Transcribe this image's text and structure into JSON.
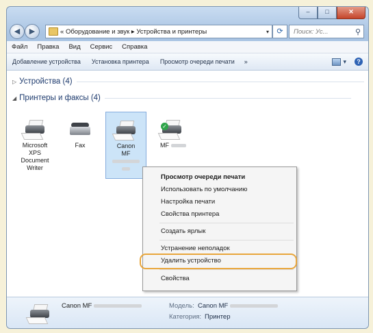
{
  "window": {
    "controls": {
      "minimize": "–",
      "maximize": "□",
      "close": "✕"
    }
  },
  "address": {
    "back": "◀",
    "forward": "▶",
    "breadcrumb_prefix": "«",
    "crumb1": "Оборудование и звук",
    "sep": "▸",
    "crumb2": "Устройства и принтеры",
    "dropdown": "▾",
    "refresh": "⟳",
    "search_placeholder": "Поиск: Ус...",
    "search_glyph": "⚲"
  },
  "menu": [
    "Файл",
    "Правка",
    "Вид",
    "Сервис",
    "Справка"
  ],
  "commands": {
    "add_device": "Добавление устройства",
    "install_printer": "Установка принтера",
    "view_queue": "Просмотр очереди печати",
    "more": "»",
    "view_dropdown": "▾",
    "help": "?"
  },
  "groups": {
    "devices": {
      "arrow": "▷",
      "title": "Устройства (4)"
    },
    "printers": {
      "arrow": "◢",
      "title": "Принтеры и факсы (4)"
    }
  },
  "printers": [
    {
      "line1": "Microsoft",
      "line2": "XPS",
      "line3": "Document",
      "line4": "Writer"
    },
    {
      "line1": "Fax"
    },
    {
      "line1": "Canon",
      "line2": "MF"
    },
    {
      "line1": "MF",
      "default_check": "✓"
    }
  ],
  "context_menu": {
    "view_queue": "Просмотр очереди печати",
    "set_default": "Использовать по умолчанию",
    "print_prefs": "Настройка печати",
    "printer_props": "Свойства принтера",
    "create_shortcut": "Создать ярлык",
    "troubleshoot": "Устранение неполадок",
    "remove_device": "Удалить устройство",
    "properties": "Свойства"
  },
  "details": {
    "name": "Canon MF",
    "model_label": "Модель:",
    "model_value": "Canon MF",
    "category_label": "Категория:",
    "category_value": "Принтер"
  },
  "colors": {
    "highlight": "#e8a53a",
    "selection": "#cce4f8",
    "background": "#f6f1d9"
  }
}
